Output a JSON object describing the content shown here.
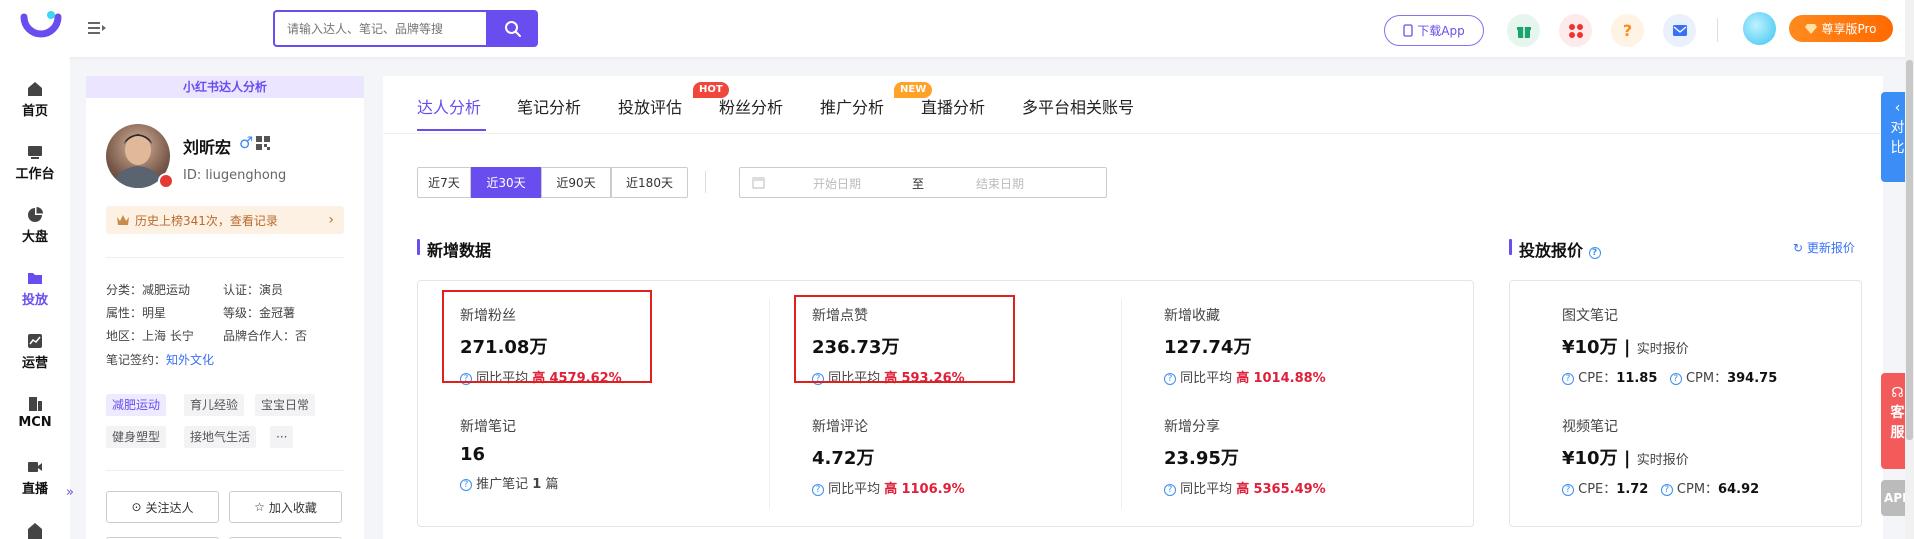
{
  "topbar": {
    "search_placeholder": "请输入达人、笔记、品牌等搜",
    "download_app": "下载App",
    "vip_label": "尊享版Pro"
  },
  "leftnav": {
    "items": [
      {
        "label": "首页"
      },
      {
        "label": "工作台"
      },
      {
        "label": "大盘"
      },
      {
        "label": "投放"
      },
      {
        "label": "运营"
      },
      {
        "label": "MCN"
      },
      {
        "label": "直播"
      }
    ],
    "active_index": 3,
    "collapse_glyph": "»"
  },
  "profile": {
    "header": "小红书达人分析",
    "name": "刘昕宏",
    "gender_glyph": "♂",
    "id_label": "ID:",
    "id_value": "liugenghong",
    "history": "历史上榜341次，查看记录",
    "attrs": {
      "category": "分类：减肥运动",
      "cert": "认证：演员",
      "property": "属性：明星",
      "level": "等级：金冠薯",
      "region": "地区：上海 长宁",
      "brand_partner": "品牌合作人：否",
      "contract_label": "笔记签约：",
      "contract_value": "知外文化"
    },
    "tags": [
      "减肥运动",
      "育儿经验",
      "宝宝日常",
      "健身塑型",
      "接地气生活",
      "···"
    ],
    "follow_btn": "关注达人",
    "favorite_btn": "加入收藏"
  },
  "tabs": [
    {
      "label": "达人分析"
    },
    {
      "label": "笔记分析"
    },
    {
      "label": "投放评估",
      "badge": "HOT"
    },
    {
      "label": "粉丝分析"
    },
    {
      "label": "推广分析",
      "badge": "NEW"
    },
    {
      "label": "直播分析"
    },
    {
      "label": "多平台相关账号"
    }
  ],
  "date_ranges": [
    "近7天",
    "近30天",
    "近90天",
    "近180天"
  ],
  "active_range": 1,
  "date_picker": {
    "start": "开始日期",
    "to": "至",
    "end": "结束日期"
  },
  "new_data": {
    "title": "新增数据",
    "metrics": [
      {
        "label": "新增粉丝",
        "value": "271.08万",
        "cmp_label": "同比平均",
        "cmp_dir": "高",
        "cmp_value": "4579.62%"
      },
      {
        "label": "新增点赞",
        "value": "236.73万",
        "cmp_label": "同比平均",
        "cmp_dir": "高",
        "cmp_value": "593.26%"
      },
      {
        "label": "新增收藏",
        "value": "127.74万",
        "cmp_label": "同比平均",
        "cmp_dir": "高",
        "cmp_value": "1014.88%"
      },
      {
        "label": "新增笔记",
        "value": "16",
        "cmp_label": "推广笔记",
        "cmp_dir": "1",
        "cmp_value": "篇"
      },
      {
        "label": "新增评论",
        "value": "4.72万",
        "cmp_label": "同比平均",
        "cmp_dir": "高",
        "cmp_value": "1106.9%"
      },
      {
        "label": "新增分享",
        "value": "23.95万",
        "cmp_label": "同比平均",
        "cmp_dir": "高",
        "cmp_value": "5365.49%"
      }
    ]
  },
  "pricing": {
    "title": "投放报价",
    "update_label": "更新报价",
    "items": [
      {
        "label": "图文笔记",
        "price": "¥10万",
        "rt": "实时报价",
        "cpe_label": "CPE：",
        "cpe": "11.85",
        "cpm_label": "CPM：",
        "cpm": "394.75"
      },
      {
        "label": "视频笔记",
        "price": "¥10万",
        "rt": "实时报价",
        "cpe_label": "CPE：",
        "cpe": "1.72",
        "cpm_label": "CPM：",
        "cpm": "64.92"
      }
    ]
  },
  "right_float": {
    "compare": "对比",
    "service": "客服",
    "app": "APP"
  }
}
